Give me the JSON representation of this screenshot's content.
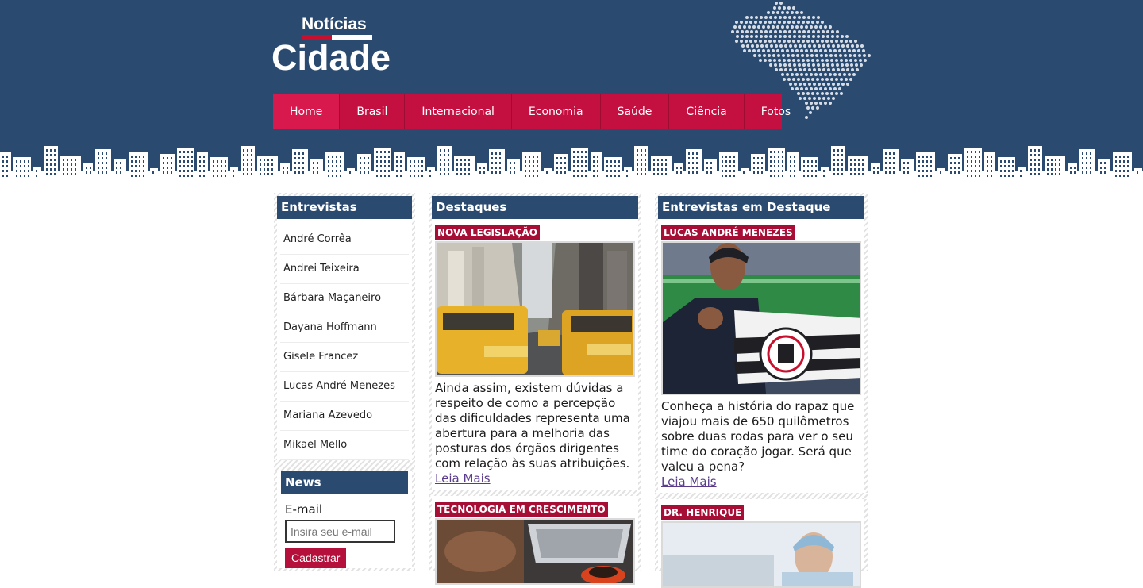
{
  "logo": {
    "small": "Notícias",
    "big": "Cidade"
  },
  "nav": [
    {
      "label": "Home",
      "active": true
    },
    {
      "label": "Brasil"
    },
    {
      "label": "Internacional"
    },
    {
      "label": "Economia"
    },
    {
      "label": "Saúde"
    },
    {
      "label": "Ciência"
    },
    {
      "label": "Fotos"
    }
  ],
  "interviews": {
    "title": "Entrevistas",
    "items": [
      "André Corrêa",
      "Andrei Teixeira",
      "Bárbara Maçaneiro",
      "Dayana Hoffmann",
      "Gisele Francez",
      "Lucas André Menezes",
      "Mariana Azevedo",
      "Mikael Mello"
    ]
  },
  "news": {
    "title": "News",
    "email_label": "E-mail",
    "email_placeholder": "Insira seu e-mail",
    "button": "Cadastrar"
  },
  "highlights": {
    "title": "Destaques",
    "articles": [
      {
        "tag": "NOVA LEGISLAÇÃO",
        "text": "Ainda assim, existem dúvidas a respeito de como a percepção das dificuldades representa uma abertura para a melhoria das posturas dos órgãos dirigentes com relação às suas atribuições.",
        "more": "Leia Mais"
      },
      {
        "tag": "TECNOLOGIA EM CRESCIMENTO"
      }
    ]
  },
  "featured_interviews": {
    "title": "Entrevistas em Destaque",
    "articles": [
      {
        "tag": "LUCAS ANDRÉ MENEZES",
        "text": "Conheça a história do rapaz que viajou mais de 650 quilômetros sobre duas rodas para ver o seu time do coração jogar. Será que valeu a pena?",
        "more": "Leia Mais"
      },
      {
        "tag": "DR. HENRIQUE"
      }
    ]
  },
  "colors": {
    "header": "#2b4a70",
    "accent": "#c41040",
    "tag": "#a70e36",
    "link": "#5b3c8c"
  }
}
